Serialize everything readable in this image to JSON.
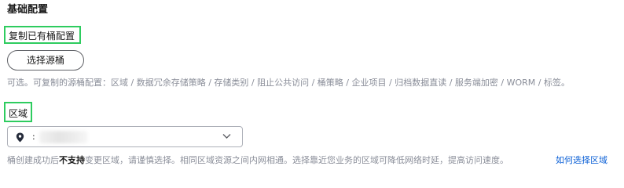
{
  "section": {
    "title": "基础配置"
  },
  "copy_bucket": {
    "label": "复制已有桶配置",
    "button_label": "选择源桶",
    "hint": "可选。可复制的源桶配置：区域 / 数据冗余存储策略 / 存储类别 / 阻止公共访问 / 桶策略 / 企业项目 / 归档数据直读 / 服务端加密 / WORM / 标签。"
  },
  "region": {
    "label": "区域",
    "select_value_prefix": ":",
    "hint_before": "桶创建成功后",
    "hint_bold": "不支持",
    "hint_after": "变更区域，请谨慎选择。相同区域资源之间内网相通。选择靠近您业务的区域可降低网络时延，提高访问速度。",
    "help_link": "如何选择区域"
  },
  "icons": {
    "location": "map-pin-icon",
    "dropdown": "chevron-down-icon"
  },
  "colors": {
    "highlight": "#2ecc5f",
    "link": "#0a5fd6",
    "hint": "#8a8e99"
  }
}
